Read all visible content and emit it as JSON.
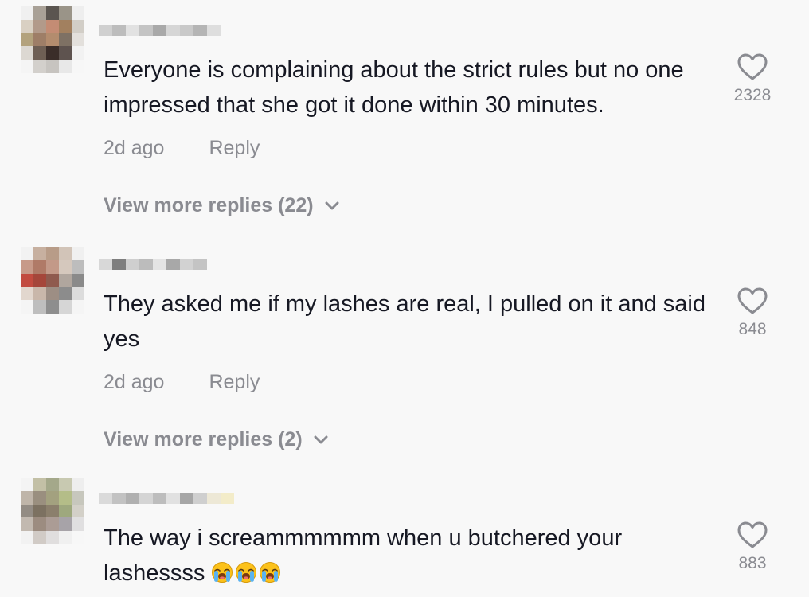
{
  "comments": [
    {
      "text": "Everyone is complaining about the strict rules but no one impressed that she got it done within 30 minutes.",
      "time": "2d ago",
      "reply": "Reply",
      "more_replies": "View more replies (22)",
      "likes": "2328",
      "avatar_colors": [
        "#f0f0f0",
        "#a9a197",
        "#5b5550",
        "#9a9488",
        "#eeeeee",
        "#d9d0c3",
        "#b29a8a",
        "#c48c74",
        "#a2805f",
        "#d2cec7",
        "#b3a27d",
        "#9e7e67",
        "#b38c6e",
        "#7e7164",
        "#e3e0dc",
        "#dcd8d2",
        "#6e5f54",
        "#3a2d29",
        "#5e534f",
        "#f2f2f2",
        "#f5f5f5",
        "#d3d0cc",
        "#c7c4c0",
        "#e8e8e8",
        "#f7f7f7"
      ]
    },
    {
      "text": "They asked me if my lashes are real, I pulled on it and said yes",
      "time": "2d ago",
      "reply": "Reply",
      "more_replies": "View more replies (2)",
      "likes": "848",
      "avatar_colors": [
        "#f2f2f2",
        "#c7b0a0",
        "#b89c88",
        "#d2c4b8",
        "#f0f0f0",
        "#c79a89",
        "#b07a67",
        "#c39988",
        "#d5c8bd",
        "#bdbdbd",
        "#c24b3f",
        "#a5463a",
        "#8f5a4e",
        "#b0a69e",
        "#8a8a8a",
        "#e2d7ce",
        "#c9b7aa",
        "#9d8e84",
        "#8c8c8c",
        "#dcdcdc",
        "#f5f5f5",
        "#bebebe",
        "#8e8e8e",
        "#d6d6d6",
        "#f5f5f5"
      ]
    },
    {
      "text": "The way i screammmmmm when u butchered your lashessss",
      "time": "",
      "reply": "",
      "more_replies": "",
      "likes": "883",
      "avatar_colors": [
        "#f4f4f4",
        "#c3c0a6",
        "#a4a88a",
        "#c8c9b1",
        "#eeeeee",
        "#bfb5a9",
        "#9a8f7f",
        "#a3a17f",
        "#b4bd88",
        "#c7c7bd",
        "#938c84",
        "#7c7161",
        "#8b7f6c",
        "#9ea87e",
        "#d3d0c8",
        "#c2b9b0",
        "#9c8c80",
        "#ab9c95",
        "#a7a3a8",
        "#e0dfe0",
        "#f2f2f2",
        "#d1cbc6",
        "#e0dede",
        "#f0f0f0",
        "#f7f7f7"
      ],
      "emoji_count": 3
    }
  ]
}
